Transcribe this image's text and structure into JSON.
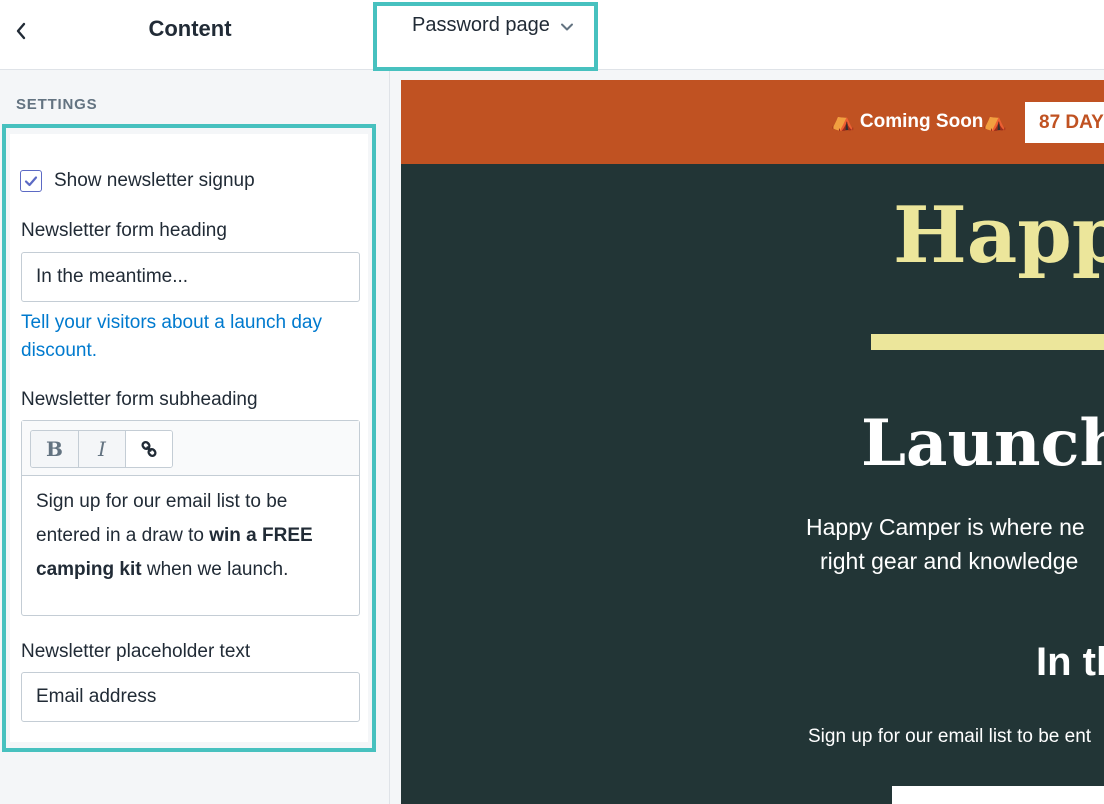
{
  "sidebar": {
    "title": "Content",
    "section_label": "SETTINGS",
    "show_newsletter": {
      "label": "Show newsletter signup",
      "checked": true
    },
    "form_heading": {
      "label": "Newsletter form heading",
      "value": "In the meantime..."
    },
    "help_link": "Tell your visitors about a launch day discount.",
    "form_subheading": {
      "label": "Newsletter form subheading",
      "toolbar": {
        "bold": "B",
        "italic": "I"
      },
      "content": {
        "part1": "Sign up for our email list to be entered in a draw to ",
        "bold": "win a FREE camping kit",
        "part2": " when we launch."
      }
    },
    "placeholder_text": {
      "label": "Newsletter placeholder text",
      "value": "Email address"
    }
  },
  "topbar": {
    "page_selector": "Password page"
  },
  "preview": {
    "announcement": "⛺ Coming Soon⛺",
    "countdown": "87 DAY",
    "store_title": "Happ",
    "launch_heading": "Launch",
    "description_line1": "Happy Camper is where ne",
    "description_line2": "right gear and knowledge",
    "newsletter_heading": "In th",
    "newsletter_sub": "Sign up for our email list to be ent"
  },
  "colors": {
    "highlight": "#47c1bf",
    "announcement_bg": "#c05222",
    "store_bg": "#223536",
    "title_yellow": "#ece69b",
    "link_blue": "#007ace",
    "checkbox_purple": "#5c6ac4"
  }
}
